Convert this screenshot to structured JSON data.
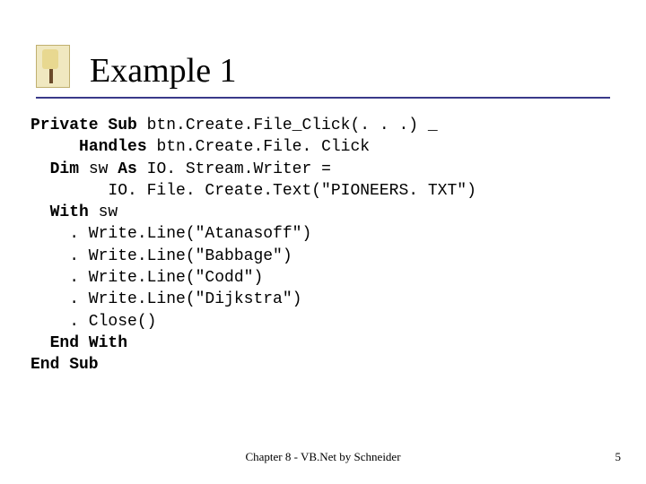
{
  "title": "Example 1",
  "code": {
    "kw_private_sub": "Private Sub",
    "l1_rest": " btn.Create.File_Click(. . .) _",
    "kw_handles": "Handles",
    "l2_rest": " btn.Create.File. Click",
    "kw_dim": "Dim",
    "l3_mid": " sw ",
    "kw_as": "As",
    "l3_rest": " IO. Stream.Writer =",
    "l4": "        IO. File. Create.Text(\"PIONEERS. TXT\")",
    "kw_with": "With",
    "l5_rest": " sw",
    "l6": "    . Write.Line(\"Atanasoff\")",
    "l7": "    . Write.Line(\"Babbage\")",
    "l8": "    . Write.Line(\"Codd\")",
    "l9": "    . Write.Line(\"Dijkstra\")",
    "l10": "    . Close()",
    "kw_end_with": "End With",
    "kw_end_sub": "End Sub"
  },
  "footer": "Chapter 8 - VB.Net by Schneider",
  "page_num": "5"
}
